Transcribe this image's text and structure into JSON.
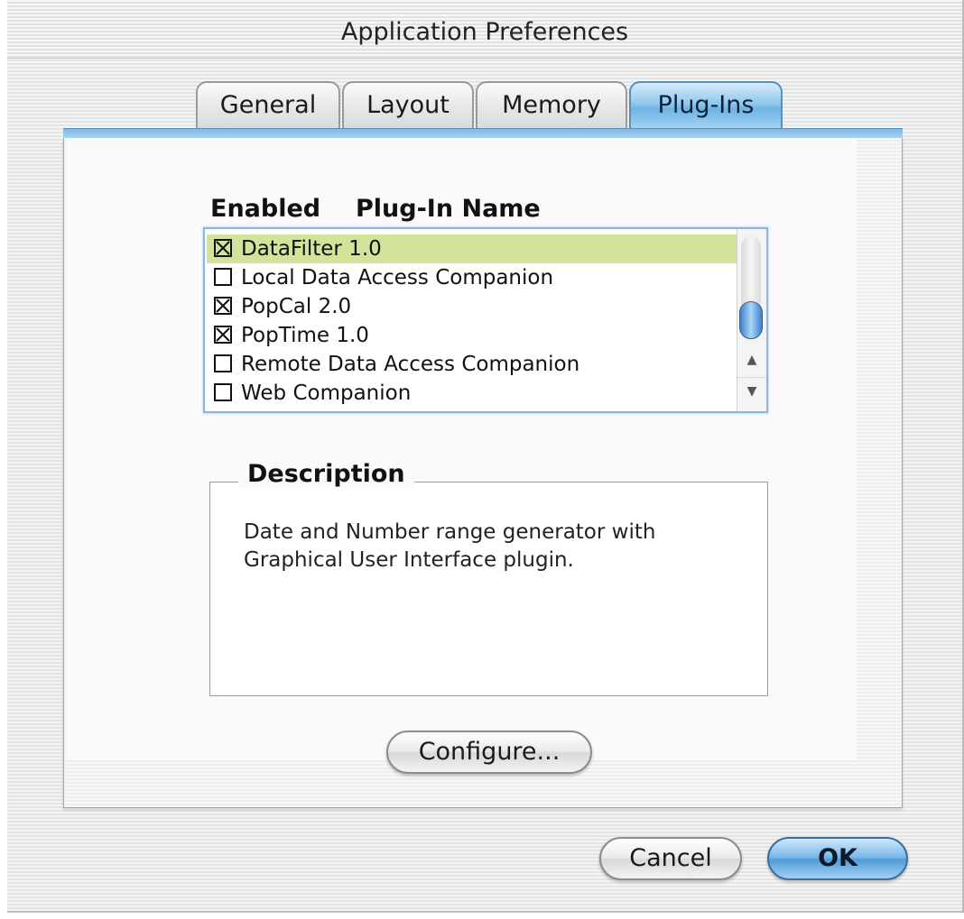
{
  "window": {
    "title": "Application Preferences"
  },
  "tabs": [
    {
      "label": "General",
      "selected": false
    },
    {
      "label": "Layout",
      "selected": false
    },
    {
      "label": "Memory",
      "selected": false
    },
    {
      "label": "Plug-Ins",
      "selected": true
    }
  ],
  "plugins": {
    "col_enabled": "Enabled",
    "col_name": "Plug-In Name",
    "items": [
      {
        "name": "DataFilter 1.0",
        "enabled": true,
        "selected": true
      },
      {
        "name": "Local Data Access Companion",
        "enabled": false,
        "selected": false
      },
      {
        "name": "PopCal 2.0",
        "enabled": true,
        "selected": false
      },
      {
        "name": "PopTime 1.0",
        "enabled": true,
        "selected": false
      },
      {
        "name": "Remote Data Access Companion",
        "enabled": false,
        "selected": false
      },
      {
        "name": "Web Companion",
        "enabled": false,
        "selected": false
      }
    ],
    "scroll_up_glyph": "▲",
    "scroll_down_glyph": "▼"
  },
  "description": {
    "title": "Description",
    "line1": "Date and Number range generator with",
    "line2": "Graphical User Interface plugin."
  },
  "buttons": {
    "configure": "Configure...",
    "cancel": "Cancel",
    "ok": "OK"
  },
  "colors": {
    "accent": "#76b6e8",
    "selected_row": "#d2e39a"
  }
}
